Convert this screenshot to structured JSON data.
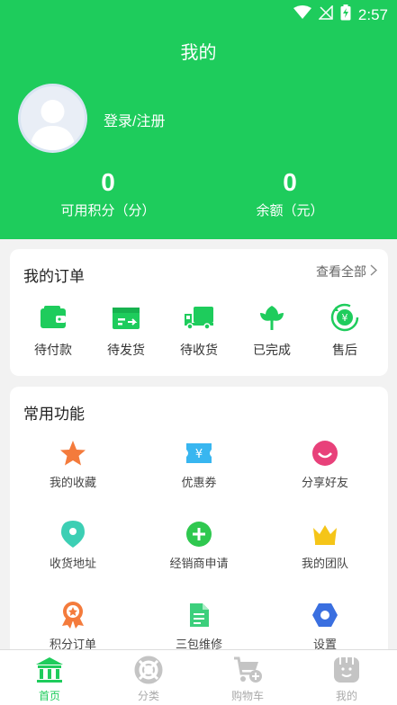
{
  "status_bar": {
    "time": "2:57"
  },
  "page": {
    "title": "我的"
  },
  "profile": {
    "login_label": "登录/注册"
  },
  "stats": [
    {
      "value": "0",
      "label": "可用积分（分）"
    },
    {
      "value": "0",
      "label": "余额（元）"
    }
  ],
  "orders": {
    "title": "我的订单",
    "view_all": "查看全部",
    "items": [
      {
        "label": "待付款",
        "icon": "wallet-icon"
      },
      {
        "label": "待发货",
        "icon": "box-icon"
      },
      {
        "label": "待收货",
        "icon": "truck-icon"
      },
      {
        "label": "已完成",
        "icon": "flower-icon"
      },
      {
        "label": "售后",
        "icon": "refund-icon"
      }
    ]
  },
  "functions": {
    "title": "常用功能",
    "items": [
      {
        "label": "我的收藏",
        "icon": "star-icon",
        "color": "#f47b3c"
      },
      {
        "label": "优惠券",
        "icon": "coupon-icon",
        "color": "#38b6f0"
      },
      {
        "label": "分享好友",
        "icon": "smile-icon",
        "color": "#e8417a"
      },
      {
        "label": "收货地址",
        "icon": "location-icon",
        "color": "#3ccfb4"
      },
      {
        "label": "经销商申请",
        "icon": "plus-icon",
        "color": "#2fc84f"
      },
      {
        "label": "我的团队",
        "icon": "crown-icon",
        "color": "#f5c518"
      },
      {
        "label": "积分订单",
        "icon": "medal-icon",
        "color": "#f47b3c"
      },
      {
        "label": "三包维修",
        "icon": "document-icon",
        "color": "#3ccf7c"
      },
      {
        "label": "设置",
        "icon": "settings-icon",
        "color": "#3a6fe0"
      }
    ]
  },
  "tabs": [
    {
      "label": "首页",
      "icon": "home-icon",
      "active": true
    },
    {
      "label": "分类",
      "icon": "category-icon",
      "active": false
    },
    {
      "label": "购物车",
      "icon": "cart-icon",
      "active": false
    },
    {
      "label": "我的",
      "icon": "profile-icon",
      "active": false
    }
  ],
  "colors": {
    "brand": "#1ecc5c",
    "background": "#f2f2f2",
    "inactive_tab": "#aaaaaa"
  }
}
